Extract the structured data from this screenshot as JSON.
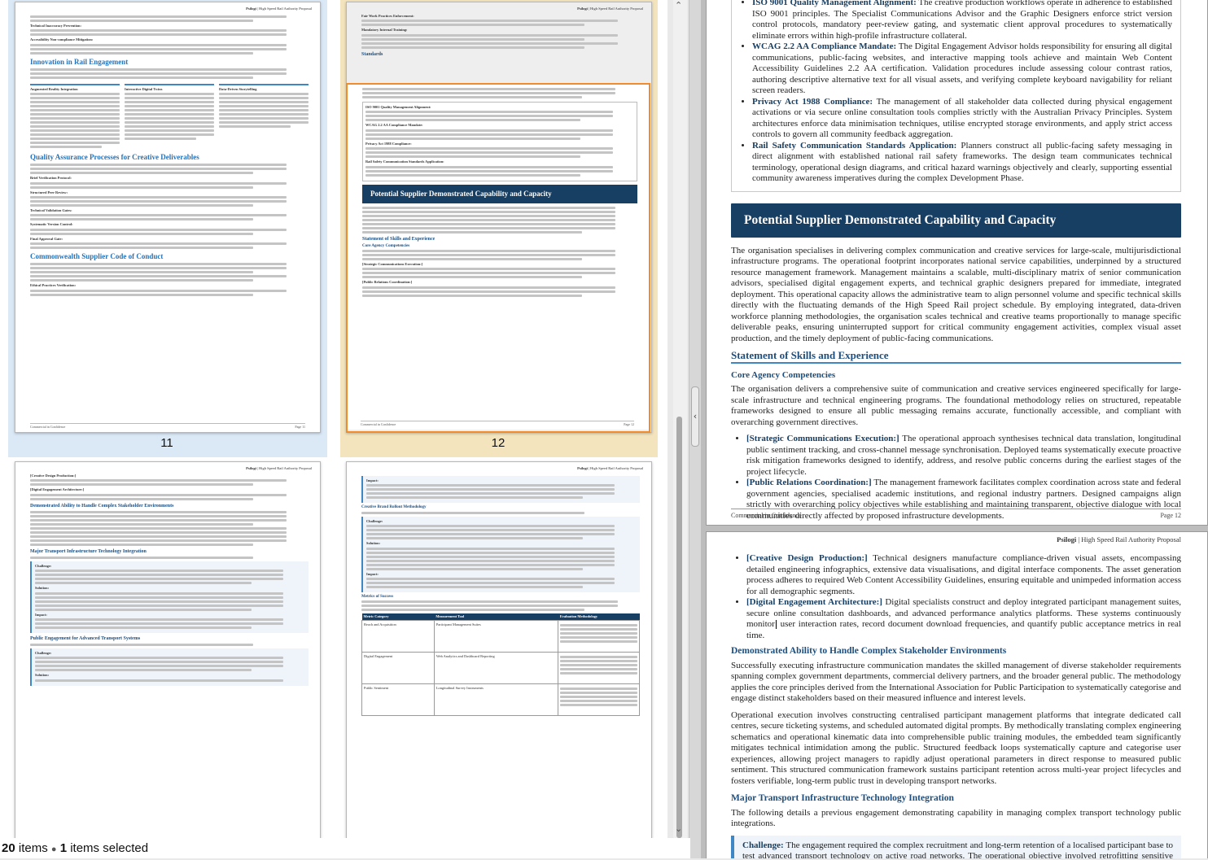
{
  "status_bar": {
    "count": "20",
    "items_word": "items",
    "selected_count": "1",
    "selected_word": "items selected"
  },
  "thumbnails": {
    "page11": {
      "number": "11"
    },
    "page12": {
      "number": "12"
    },
    "header_brand": "Psilogi",
    "header_title": "| High Speed Rail Authority Proposal",
    "footer_left": "Commercial in Confidence",
    "footer_page11": "Page 11",
    "footer_page12": "Page 12",
    "t11": {
      "b1": "Technical Inaccuracy Prevention:",
      "b2": "Accessibility Non-compliance Mitigation:",
      "h_rail": "Innovation in Rail Engagement",
      "col1": "Augmented Reality Integration",
      "col2": "Interactive Digital Twins",
      "col3": "Data-Driven Storytelling",
      "h_qa": "Quality Assurance Processes for Creative Deliverables",
      "qa1": "Brief Verification Protocol:",
      "qa2": "Structured Peer Review:",
      "qa3": "Technical Validation Gates:",
      "qa4": "Systematic Version Control:",
      "qa5": "Final Approval Gate:",
      "h_code": "Commonwealth Supplier Code of Conduct",
      "code1": "Ethical Practices Verification:"
    },
    "t12": {
      "b1": "Fair Work Practices Enforcement:",
      "b2": "Mandatory Internal Training:",
      "h_std": "Standards",
      "s1": "ISO 9001 Quality Management Alignment:",
      "s2": "WCAG 2.2 AA Compliance Mandate:",
      "s3": "Privacy Act 1988 Compliance:",
      "s4": "Rail Safety Communication Standards Application:",
      "band": "Potential Supplier Demonstrated Capability and Capacity",
      "h_skills": "Statement of Skills and Experience",
      "h_core": "Core Agency Competencies",
      "c1": "[Strategic Communications Execution:]",
      "c2": "[Public Relations Coordination:]"
    },
    "t13": {
      "c1": "[Creative Design Production:]",
      "c2": "[Digital Engagement Architecture:]",
      "h1": "Demonstrated Ability to Handle Complex Stakeholder Environments",
      "h2": "Major Transport Infrastructure Technology Integration",
      "challenge": "Challenge:",
      "solution": "Solution:",
      "impact": "Impact:",
      "h3": "Public Engagement for Advanced Transport Systems"
    },
    "t14": {
      "impact": "Impact:",
      "h1": "Creative Brand Rollout Methodology",
      "challenge": "Challenge:",
      "solution": "Solution:",
      "h2": "Metrics of Success",
      "th1": "Metric Category",
      "th2": "Measurement Tool",
      "th3": "Evaluation Methodology",
      "r1c1": "Reach and Acquisition",
      "r1c2": "Participant Management Suites",
      "r2c1": "Digital Engagement",
      "r2c2": "Web Analytics and Dashboard Reporting",
      "r3c1": "Public Sentiment",
      "r3c2": "Longitudinal Survey Instruments"
    }
  },
  "preview": {
    "bullets_top": [
      {
        "label": "ISO 9001 Quality Management Alignment:",
        "text": " The creative production workflows operate in adherence to established ISO 9001 principles. The Specialist Communications Advisor and the Graphic Designers enforce strict version control protocols, mandatory peer-review gating, and systematic client approval procedures to systematically eliminate errors within high-profile infrastructure collateral."
      },
      {
        "label": "WCAG 2.2 AA Compliance Mandate:",
        "text": " The Digital Engagement Advisor holds responsibility for ensuring all digital communications, public-facing websites, and interactive mapping tools achieve and maintain Web Content Accessibility Guidelines 2.2 AA certification. Validation procedures include assessing colour contrast ratios, authoring descriptive alternative text for all visual assets, and verifying complete keyboard navigability for reliant screen readers."
      },
      {
        "label": "Privacy Act 1988 Compliance:",
        "text": " The management of all stakeholder data collected during physical engagement activations or via secure online consultation tools complies strictly with the Australian Privacy Principles. System architectures enforce data minimisation techniques, utilise encrypted storage environments, and apply strict access controls to govern all community feedback aggregation."
      },
      {
        "label": "Rail Safety Communication Standards Application:",
        "text": " Planners construct all public-facing safety messaging in direct alignment with established national rail safety frameworks. The design team communicates technical terminology, operational design diagrams, and critical hazard warnings objectively and clearly, supporting essential community awareness imperatives during the complex Development Phase."
      }
    ],
    "band_title": "Potential Supplier Demonstrated Capability and Capacity",
    "capability_para": "The organisation specialises in delivering complex communication and creative services for large-scale, multijurisdictional infrastructure programs. The operational footprint incorporates national service capabilities, underpinned by a structured resource management framework. Management maintains a scalable, multi-disciplinary matrix of senior communication advisors, specialised digital engagement experts, and technical graphic designers prepared for immediate, integrated deployment. This operational capacity allows the administrative team to align personnel volume and specific technical skills directly with the fluctuating demands of the High Speed Rail project schedule. By employing integrated, data-driven workforce planning methodologies, the organisation scales technical and creative teams proportionally to manage specific deliverable peaks, ensuring uninterrupted support for critical community engagement activities, complex visual asset production, and the timely deployment of public-facing communications.",
    "skills_heading": "Statement of Skills and Experience",
    "core_heading": "Core Agency Competencies",
    "core_para": "The organisation delivers a comprehensive suite of communication and creative services engineered specifically for large-scale infrastructure and technical engineering programs. The foundational methodology relies on structured, repeatable frameworks designed to ensure all public messaging remains accurate, functionally accessible, and compliant with overarching government directives.",
    "core_bullets": [
      {
        "label": "[Strategic Communications Execution:]",
        "text": " The operational approach synthesises technical data translation, longitudinal public sentiment tracking, and cross-channel message synchronisation. Deployed teams systematically execute proactive risk mitigation frameworks designed to identify, address, and resolve public concerns during the earliest stages of the project lifecycle."
      },
      {
        "label": "[Public Relations Coordination:]",
        "text": " The management framework facilitates complex coordination across state and federal government agencies, specialised academic institutions, and regional industry partners. Designed campaigns align strictly with overarching policy objectives while establishing and maintaining transparent, objective dialogue with local communities directly affected by proposed infrastructure developments."
      }
    ],
    "footer_left": "Commercial in Confidence",
    "footer_right": "Page 12",
    "header_brand": "Psilogi",
    "header_title": "| High Speed Rail Authority Proposal",
    "p13_bullets": [
      {
        "label": "[Creative Design Production:]",
        "text": " Technical designers manufacture compliance-driven visual assets, encompassing detailed engineering infographics, extensive data visualisations, and digital interface components. The asset generation process adheres to required Web Content Accessibility Guidelines, ensuring equitable and unimpeded information access for all demographic segments."
      },
      {
        "label": "[Digital Engagement Architecture:]",
        "text_a": " Digital specialists construct and deploy integrated participant management suites, secure online consultation dashboards, and advanced performance analytics platforms. These systems continuously monitor",
        "text_b": " user interaction rates, record document download frequencies, and quantify public acceptance metrics in real time."
      }
    ],
    "p13_h1": "Demonstrated Ability to Handle Complex Stakeholder Environments",
    "p13_para1": "Successfully executing infrastructure communication mandates the skilled management of diverse stakeholder requirements spanning complex government departments, commercial delivery partners, and the broader general public. The methodology applies the core principles derived from the International Association for Public Participation to systematically categorise and engage distinct stakeholders based on their measured influence and interest levels.",
    "p13_para2": "Operational execution involves constructing centralised participant management platforms that integrate dedicated call centres, secure ticketing systems, and scheduled automated digital prompts. By methodically translating complex engineering schematics and operational kinematic data into comprehensible public training modules, the embedded team significantly mitigates technical intimidation among the public. Structured feedback loops systematically capture and categorise user experiences, allowing project managers to rapidly adjust operational parameters in direct response to measured public sentiment. This structured communication framework sustains participant retention across multi-year project lifecycles and fosters verifiable, long-term public trust in developing transport networks.",
    "p13_h2": "Major Transport Infrastructure Technology Integration",
    "p13_para3": "The following details a previous engagement demonstrating capability in managing complex transport technology public integrations.",
    "p13_challenge_label": "Challenge:",
    "p13_challenge_text": " The engagement required the complex recruitment and long-term retention of a localised participant base to test advanced transport technology on active road networks. The operational objective involved retrofitting sensitive technical equipment into private vehicles and seamlessly integrating novel safety messaging into daily driving routines over a continuous"
  }
}
